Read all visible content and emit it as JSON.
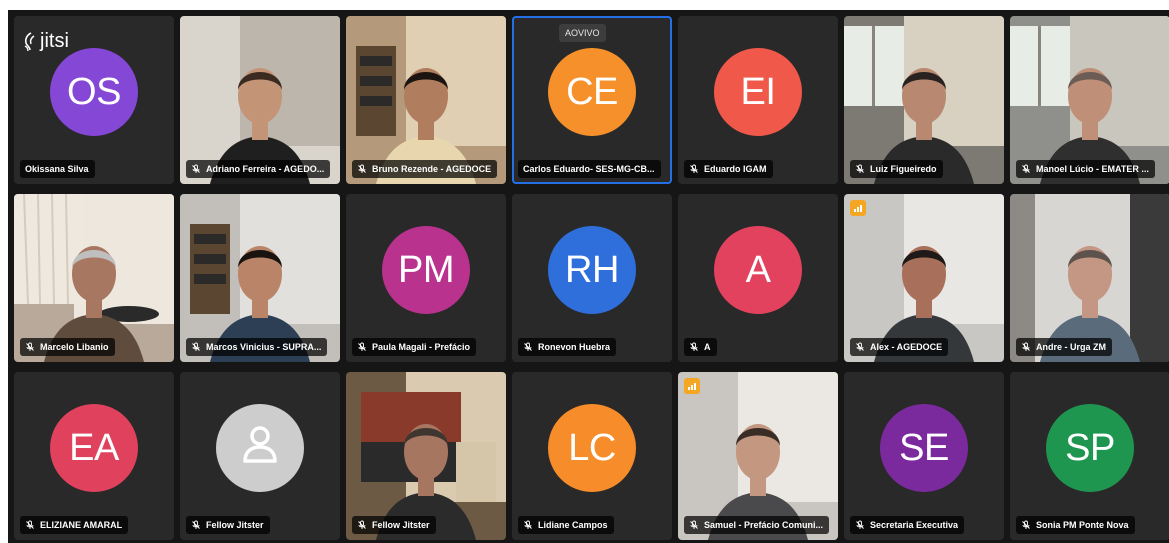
{
  "watermark": {
    "text": "jitsi",
    "icon": "jitsi-logo-icon"
  },
  "live_label": "AOVIVO",
  "colors": {
    "orange": "#f68c2a",
    "coral": "#f1574a",
    "purple": "#7d4dd1",
    "magenta": "#b8328e",
    "blue": "#2f6fdb",
    "pink": "#e33f5f",
    "violet": "#7b2a9e",
    "green": "#1e9650",
    "gray": "#cfcfcf"
  },
  "participants": [
    {
      "name": "Okissana Silva",
      "initials": "OS",
      "color": "#8447d6"
    },
    {
      "name": "Adriano Ferreira - AGEDO...",
      "video": "video"
    },
    {
      "name": "Bruno Rezende - AGEDOCE",
      "video": "video"
    },
    {
      "name": "Carlos Eduardo- SES-MG-CB...",
      "initials": "CE",
      "color": "#f6902b"
    },
    {
      "name": "Eduardo IGAM",
      "initials": "EI",
      "color": "#f0594a"
    },
    {
      "name": "Luiz Figueiredo",
      "video": "video"
    },
    {
      "name": "Manoel Lúcio - EMATER ...",
      "video": "video"
    },
    {
      "name": "Marcelo Libanio",
      "video": "video"
    },
    {
      "name": "Marcos Vinicius - SUPRA...",
      "video": "video"
    },
    {
      "name": "Paula Magali - Prefácio",
      "initials": "PM",
      "color": "#b8328e"
    },
    {
      "name": "Ronevon Huebra",
      "initials": "RH",
      "color": "#2f6fdb"
    },
    {
      "name": "A",
      "initials": "A",
      "color": "#e3425e"
    },
    {
      "name": "Alex - AGEDOCE",
      "video": "video"
    },
    {
      "name": "Andre - Urga ZM",
      "video": "video"
    },
    {
      "name": "ELIZIANE AMARAL",
      "initials": "EA",
      "color": "#e0415d"
    },
    {
      "name": "Fellow Jitster",
      "initials": "",
      "color": "#cdcdcd"
    },
    {
      "name": "Fellow Jitster",
      "video": "video"
    },
    {
      "name": "Lidiane Campos",
      "initials": "LC",
      "color": "#f68c2a"
    },
    {
      "name": "Samuel - Prefácio Comuni...",
      "video": "video"
    },
    {
      "name": "Secretaria Executiva",
      "initials": "SE",
      "color": "#7b2a9e"
    },
    {
      "name": "Sonia PM Ponte Nova",
      "initials": "SP",
      "color": "#1e9650"
    }
  ]
}
